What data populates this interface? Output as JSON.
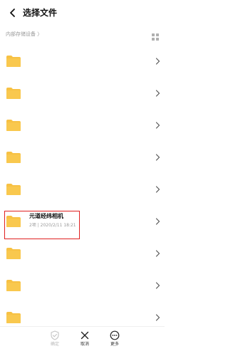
{
  "header": {
    "title": "选择文件"
  },
  "breadcrumb": {
    "label": "内部存储设备 〉"
  },
  "list": {
    "highlighted_item": {
      "name": "元道经纬相机",
      "meta": "2项 | 2020/2/11 18:21"
    }
  },
  "toolbar": {
    "confirm_label": "确定",
    "cancel_label": "取消",
    "more_label": "更多"
  },
  "colors": {
    "folder": "#f7c144",
    "folder_dark": "#efb12e",
    "highlight_border": "#e02020",
    "muted_text": "#9a9a9a"
  },
  "icons": {
    "back": "back-arrow-icon",
    "grid": "grid-view-icon",
    "folder": "folder-icon",
    "chevron": "chevron-right-icon",
    "confirm": "shield-check-icon",
    "cancel": "close-icon",
    "more": "more-circle-icon"
  }
}
